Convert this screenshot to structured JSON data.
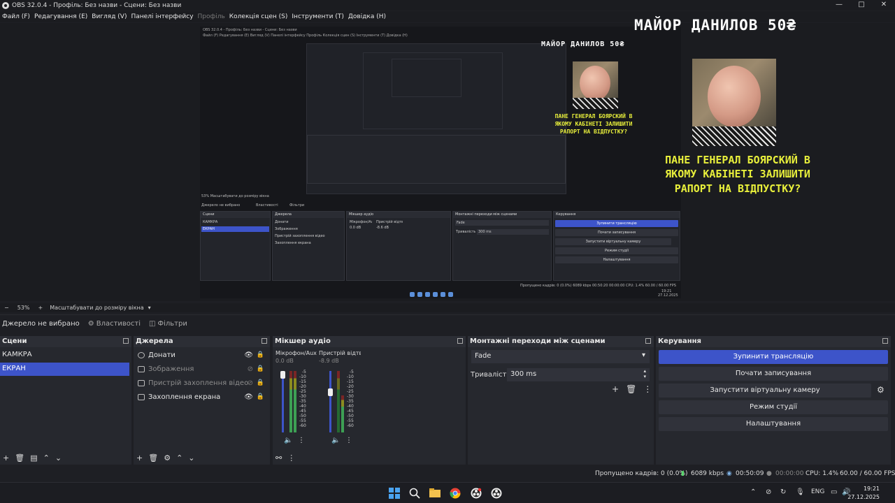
{
  "window": {
    "title": "OBS 32.0.4 - Профіль: Без назви - Сцени: Без назви",
    "controls": [
      "—",
      "□",
      "✕"
    ]
  },
  "menu": [
    {
      "label": "Файл (F)",
      "disabled": false
    },
    {
      "label": "Редагування (E)",
      "disabled": false
    },
    {
      "label": "Вигляд (V)",
      "disabled": false
    },
    {
      "label": "Панелі інтерфейсу",
      "disabled": false
    },
    {
      "label": "Профіль",
      "disabled": true
    },
    {
      "label": "Колекція сцен (S)",
      "disabled": false
    },
    {
      "label": "Інструменти (T)",
      "disabled": false
    },
    {
      "label": "Довідка (H)",
      "disabled": false
    }
  ],
  "preview": {
    "overlay_title": "МАЙОР ДАНИЛОВ 50₴",
    "overlay_question_lines": [
      "ПАНЕ ГЕНЕРАЛ БОЯРСКИЙ В",
      "ЯКОМУ КАБІНЕТІ ЗАЛИШИТИ",
      "РАПОРТ НА ВІДПУСТКУ?"
    ],
    "nested_title": "OBS 32.0.4 - Профіль: Без назви - Сцени: Без назви",
    "nested_menu": "Файл (F)   Редагування (E)   Вигляд (V)   Панелі інтерфейсу   Профіль   Колекція сцен (S)   Інструменти (T)   Довідка (H)",
    "nested_scale": "53%   Масштабувати до розміру вікна",
    "nested_no_source": "Джерело не вибрано",
    "nested_props": "Властивості",
    "nested_filters": "Фільтри",
    "nested_panels": {
      "scenes": "Сцени",
      "sources": "Джерела",
      "mixer": "Мікшер аудіо",
      "transitions": "Монтажні переходи між сценами",
      "controls": "Керування"
    },
    "nested_scenes": [
      "КАМКРА",
      "ЕКРАН"
    ],
    "nested_sources": [
      "Донати",
      "Зображення",
      "Пристрій захоплення відео",
      "Захоплення екрана"
    ],
    "nested_mixer": [
      "Мікрофон/Aux",
      "Пристрій відтворе"
    ],
    "nested_mixer_db": [
      "0.0 dB",
      "-8.6 dB"
    ],
    "nested_fade": "Fade",
    "nested_duration_label": "Тривалість",
    "nested_duration": "300 ms",
    "nested_controls": [
      "Зупинити трансляцію",
      "Почати записування",
      "Запустити віртуальну камеру",
      "Режим студії",
      "Налаштування"
    ],
    "nested_status": "Пропущено кадрів: 0 (0.0%)   6089 kbps   00:50:20   00:00:00   CPU: 1.4%   60.00 / 60.00 FPS",
    "nested_clock": [
      "19:21",
      "27.12.2025"
    ]
  },
  "scalebar": {
    "minus": "−",
    "zoom": "53%",
    "plus": "+",
    "fit_label": "Масштабувати до розміру вікна",
    "dropdown": "▾"
  },
  "propbar": {
    "no_source": "Джерело не вибрано",
    "properties": "Властивості",
    "filters": "Фільтри"
  },
  "scenes": {
    "title": "Сцени",
    "items": [
      {
        "label": "КАМКРА",
        "selected": false
      },
      {
        "label": "ЕКРАН",
        "selected": true
      }
    ],
    "footer": [
      "+",
      "🗑",
      "▤",
      "⌃",
      "⌄"
    ]
  },
  "sources": {
    "title": "Джерела",
    "items": [
      {
        "label": "Донати",
        "icon": "browser-icon",
        "visible": true
      },
      {
        "label": "Зображення",
        "icon": "image-icon",
        "visible": false
      },
      {
        "label": "Пристрій захоплення відео",
        "icon": "camera-icon",
        "visible": false
      },
      {
        "label": "Захоплення екрана",
        "icon": "monitor-icon",
        "visible": true
      }
    ],
    "footer": [
      "+",
      "🗑",
      "⚙",
      "⌃",
      "⌄"
    ]
  },
  "mixer": {
    "title": "Мікшер аудіо",
    "channels": [
      {
        "name": "Мікрофон/Aux",
        "db": "0.0 dB"
      },
      {
        "name": "Пристрій відтворе",
        "db": "-8.9 dB"
      }
    ],
    "scale": [
      "-5",
      "-10",
      "-15",
      "-20",
      "-25",
      "-30",
      "-35",
      "-40",
      "-45",
      "-50",
      "-55",
      "-60"
    ],
    "footer": [
      "⚯",
      "⋮"
    ]
  },
  "transitions": {
    "title": "Монтажні переходи між сценами",
    "selected": "Fade",
    "duration_label": "Тривалість",
    "duration": "300 ms",
    "footer": [
      "+",
      "🗑",
      "⋮"
    ]
  },
  "controls": {
    "title": "Керування",
    "buttons": [
      {
        "label": "Зупинити трансляцію",
        "primary": true
      },
      {
        "label": "Почати записування",
        "primary": false
      },
      {
        "label": "Запустити віртуальну камеру",
        "primary": false
      },
      {
        "label": "Режим студії",
        "primary": false
      },
      {
        "label": "Налаштування",
        "primary": false
      }
    ]
  },
  "status": {
    "dropped": "Пропущено кадрів: 0 (0.0%)",
    "bitrate": "6089 kbps",
    "stream_time": "00:50:09",
    "rec_time": "00:00:00",
    "cpu": "CPU: 1.4%",
    "fps": "60.00 / 60.00 FPS"
  },
  "taskbar": {
    "lang": "ENG",
    "time": "19:21",
    "date": "27.12.2025"
  },
  "colors": {
    "accent": "#3d54c9",
    "overlay_yellow": "#e8ef3b",
    "background": "#1e1f24"
  }
}
